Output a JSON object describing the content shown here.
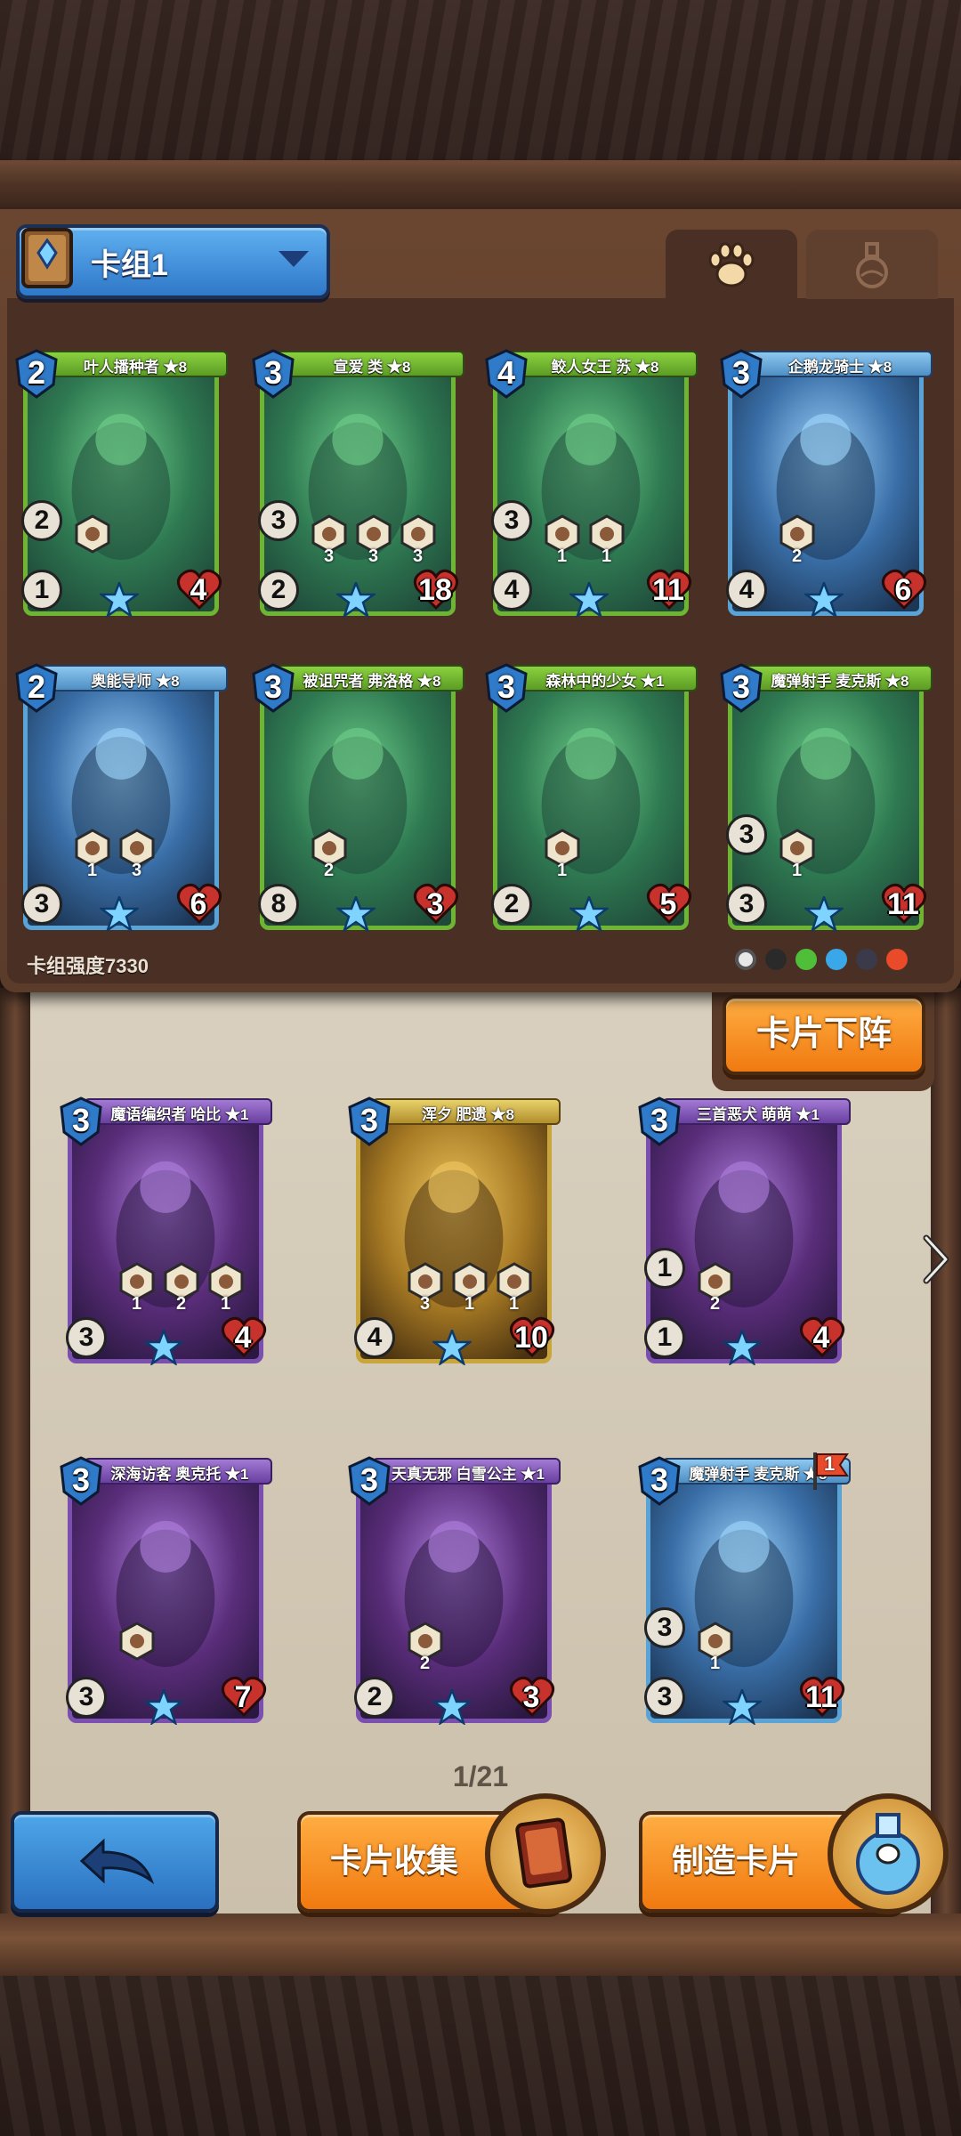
{
  "deck": {
    "name": "卡组1",
    "strength_label": "卡组强度7330"
  },
  "tabs": [
    {
      "name": "pets",
      "icon": "paw-icon"
    },
    {
      "name": "potions",
      "icon": "potion-flask-icon"
    }
  ],
  "deck_cards": [
    {
      "title": "叶人播种者 ★8",
      "cost": "2",
      "speed": "2",
      "attack": "1",
      "hp": "4",
      "rarity": "green"
    },
    {
      "title": "宣爱 类 ★8",
      "cost": "3",
      "speed": "3",
      "attack": "2",
      "hp": "18",
      "rarity": "green",
      "ability_counts": [
        "3",
        "3",
        "3"
      ]
    },
    {
      "title": "鲛人女王 苏 ★8",
      "cost": "4",
      "speed": "3",
      "attack": "4",
      "hp": "11",
      "rarity": "green",
      "ability_counts": [
        "1",
        "1"
      ]
    },
    {
      "title": "企鹅龙骑士 ★8",
      "cost": "3",
      "speed": "",
      "attack": "4",
      "hp": "6",
      "rarity": "rare",
      "ability_counts": [
        "2"
      ]
    },
    {
      "title": "奥能导师 ★8",
      "cost": "2",
      "speed": "",
      "attack": "3",
      "hp": "6",
      "rarity": "rare",
      "ability_counts": [
        "1",
        "3"
      ]
    },
    {
      "title": "被诅咒者 弗洛格 ★8",
      "cost": "3",
      "speed": "",
      "attack": "8",
      "hp": "3",
      "rarity": "green",
      "ability_counts": [
        "2"
      ]
    },
    {
      "title": "森林中的少女 ★1",
      "cost": "3",
      "speed": "",
      "attack": "2",
      "hp": "5",
      "rarity": "green",
      "ability_counts": [
        "1"
      ]
    },
    {
      "title": "魔弹射手 麦克斯 ★8",
      "cost": "3",
      "speed": "3",
      "attack": "3",
      "hp": "11",
      "rarity": "green",
      "ability_counts": [
        "1"
      ]
    }
  ],
  "filters": [
    "white",
    "black",
    "green",
    "blue",
    "dark",
    "red"
  ],
  "unassign_button": "卡片下阵",
  "collection_cards": [
    {
      "title": "魔语编织者 哈比 ★1",
      "cost": "3",
      "speed": "",
      "attack": "3",
      "hp": "4",
      "rarity": "purple",
      "ability_counts": [
        "1",
        "2",
        "1"
      ]
    },
    {
      "title": "浑夕 肥遗 ★8",
      "cost": "3",
      "speed": "",
      "attack": "4",
      "hp": "10",
      "rarity": "gold",
      "ability_counts": [
        "3",
        "1",
        "1"
      ]
    },
    {
      "title": "三首恶犬 萌萌 ★1",
      "cost": "3",
      "speed": "1",
      "attack": "1",
      "hp": "4",
      "rarity": "purple",
      "ability_counts": [
        "2"
      ]
    },
    {
      "title": "深海访客 奥克托 ★1",
      "cost": "3",
      "speed": "",
      "attack": "3",
      "hp": "7",
      "rarity": "purple"
    },
    {
      "title": "天真无邪 白雪公主 ★1",
      "cost": "3",
      "speed": "",
      "attack": "2",
      "hp": "3",
      "rarity": "purple",
      "ability_counts": [
        "2"
      ]
    },
    {
      "title": "魔弹射手 麦克斯 ★8",
      "cost": "3",
      "speed": "3",
      "attack": "3",
      "hp": "11",
      "rarity": "rare",
      "ability_counts": [
        "1"
      ],
      "flag": "1"
    }
  ],
  "pagination": "1/21",
  "bottom_buttons": {
    "collection": "卡片收集",
    "craft": "制造卡片"
  },
  "colors": {
    "panel": "#5b3b2a",
    "orange_button": "#f07a10",
    "blue_button": "#2a70c0",
    "green_frame": "#6fb534"
  }
}
